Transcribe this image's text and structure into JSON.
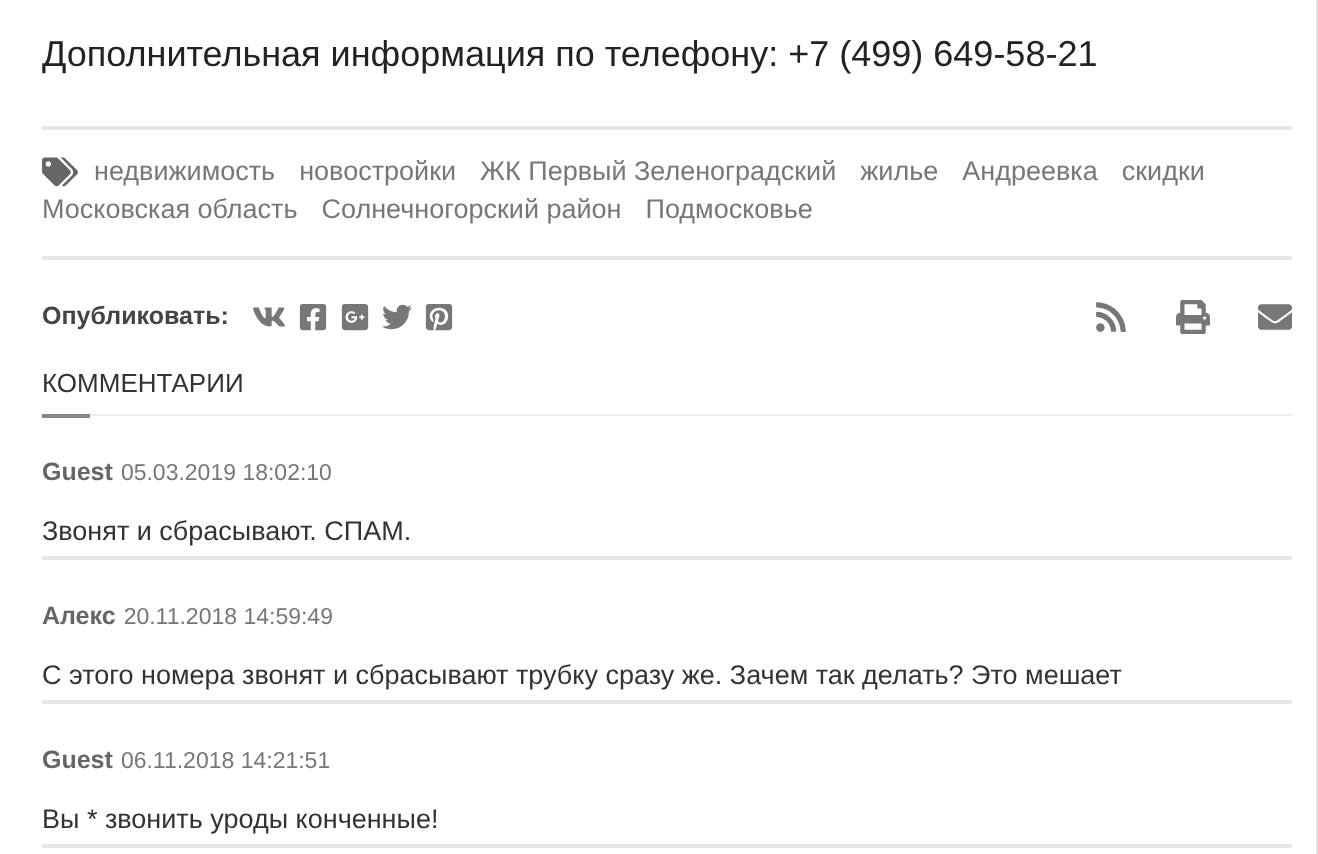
{
  "phone_line": "Дополнительная информация по телефону: +7 (499) 649-58-21",
  "tags": [
    "недвижимость",
    "новостройки",
    "ЖК Первый Зеленоградский",
    "жилье",
    "Андреевка",
    "скидки",
    "Московская область",
    "Солнечногорский район",
    "Подмосковье"
  ],
  "share": {
    "label": "Опубликовать:",
    "networks": [
      {
        "kind": "vk"
      },
      {
        "kind": "facebook"
      },
      {
        "kind": "googleplus"
      },
      {
        "kind": "twitter"
      },
      {
        "kind": "pinterest"
      }
    ],
    "actions": [
      {
        "kind": "rss"
      },
      {
        "kind": "print"
      },
      {
        "kind": "email"
      }
    ]
  },
  "comments_heading": "КОММЕНТАРИИ",
  "comments": [
    {
      "author": "Guest",
      "date": "05.03.2019 18:02:10",
      "text": "Звонят и сбрасывают. СПАМ."
    },
    {
      "author": "Алекс",
      "date": "20.11.2018 14:59:49",
      "text": "С этого номера звонят и сбрасывают трубку сразу же. Зачем так делать? Это мешает"
    },
    {
      "author": "Guest",
      "date": "06.11.2018 14:21:51",
      "text": "Вы * звонить уроды конченные!"
    }
  ]
}
